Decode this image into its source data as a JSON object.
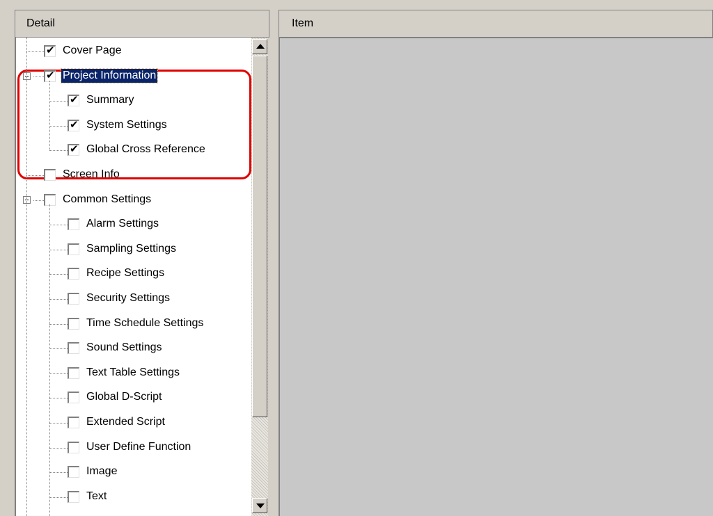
{
  "detail_panel": {
    "header": "Detail",
    "tree": [
      {
        "label": "Cover Page",
        "checked": true,
        "level": 0
      },
      {
        "label": "Project Information",
        "checked": true,
        "level": 0,
        "expanded": true,
        "selected": true
      },
      {
        "label": "Summary",
        "checked": true,
        "level": 1
      },
      {
        "label": "System Settings",
        "checked": true,
        "level": 1
      },
      {
        "label": "Global Cross Reference",
        "checked": true,
        "level": 1
      },
      {
        "label": "Screen Info",
        "checked": false,
        "level": 0
      },
      {
        "label": "Common Settings",
        "checked": false,
        "level": 0,
        "expanded": true
      },
      {
        "label": "Alarm Settings",
        "checked": false,
        "level": 1
      },
      {
        "label": "Sampling Settings",
        "checked": false,
        "level": 1
      },
      {
        "label": "Recipe Settings",
        "checked": false,
        "level": 1
      },
      {
        "label": "Security Settings",
        "checked": false,
        "level": 1
      },
      {
        "label": "Time Schedule Settings",
        "checked": false,
        "level": 1
      },
      {
        "label": "Sound Settings",
        "checked": false,
        "level": 1
      },
      {
        "label": "Text Table Settings",
        "checked": false,
        "level": 1
      },
      {
        "label": "Global D-Script",
        "checked": false,
        "level": 1
      },
      {
        "label": "Extended Script",
        "checked": false,
        "level": 1
      },
      {
        "label": "User Define Function",
        "checked": false,
        "level": 1
      },
      {
        "label": "Image",
        "checked": false,
        "level": 1
      },
      {
        "label": "Text",
        "checked": false,
        "level": 1
      }
    ]
  },
  "item_panel": {
    "header": "Item"
  },
  "colors": {
    "selection": "#0a246a",
    "highlight_border": "#e00000",
    "panel_bg": "#c8c8c8"
  }
}
